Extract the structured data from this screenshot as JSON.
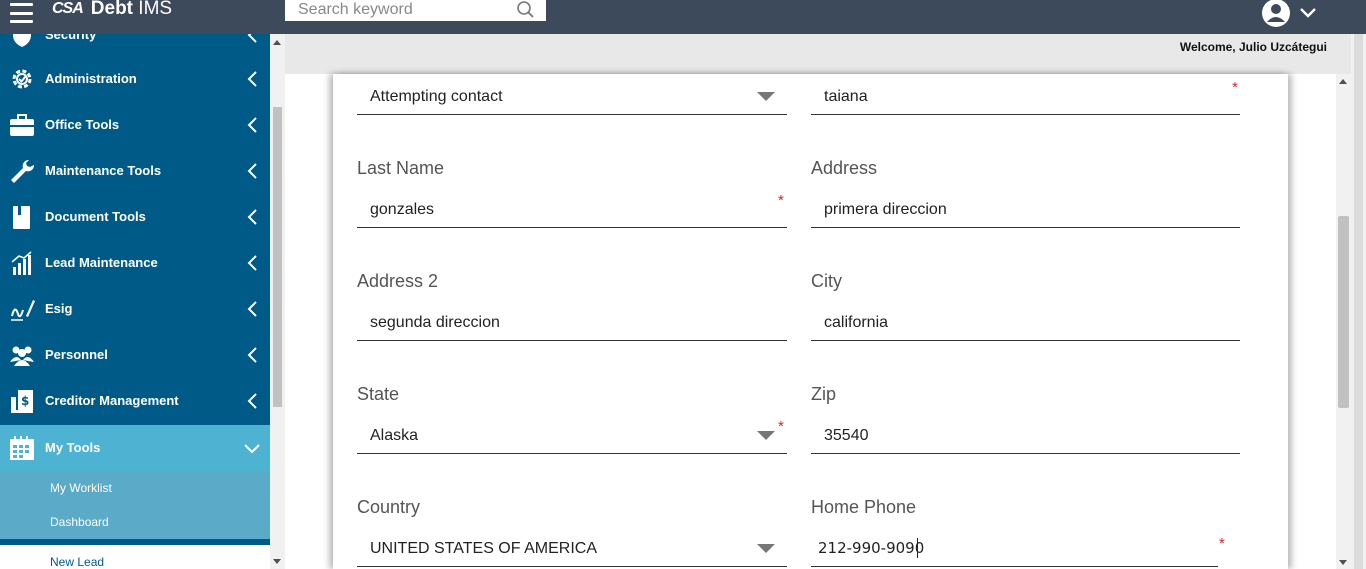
{
  "header": {
    "app_logo": "CSA",
    "app_name_bold": "Debt",
    "app_name_rest": "IMS",
    "search_placeholder": "Search keyword",
    "welcome": "Welcome, Julio Uzcátegui"
  },
  "sidebar": {
    "partial_item": "Security",
    "items": [
      {
        "label": "Administration",
        "icon": "gear-shield-icon"
      },
      {
        "label": "Office Tools",
        "icon": "briefcase-icon"
      },
      {
        "label": "Maintenance Tools",
        "icon": "wrench-icon"
      },
      {
        "label": "Document Tools",
        "icon": "book-icon"
      },
      {
        "label": "Lead Maintenance",
        "icon": "bar-chart-icon"
      },
      {
        "label": "Esig",
        "icon": "signature-icon"
      },
      {
        "label": "Personnel",
        "icon": "people-icon"
      },
      {
        "label": "Creditor Management",
        "icon": "ledger-icon"
      },
      {
        "label": "My Tools",
        "icon": "calendar-icon"
      }
    ],
    "subitems": [
      "My Worklist",
      "Dashboard",
      "New Lead"
    ]
  },
  "form": {
    "status_value": "Attempting contact",
    "first_name_value": "taiana",
    "last_name_label": "Last Name",
    "last_name_value": "gonzales",
    "address_label": "Address",
    "address_value": "primera direccion",
    "address2_label": "Address 2",
    "address2_value": "segunda direccion",
    "city_label": "City",
    "city_value": "california",
    "state_label": "State",
    "state_value": "Alaska",
    "zip_label": "Zip",
    "zip_value": "35540",
    "country_label": "Country",
    "country_value": "UNITED STATES OF AMERICA",
    "home_phone_label": "Home Phone",
    "home_phone_value": "212-990-9090",
    "required_mark": "*"
  },
  "colors": {
    "topbar": "#3d4a5c",
    "sidebar": "#005a87",
    "sidebar_active": "#4eb3d3",
    "required": "#e0202a"
  }
}
